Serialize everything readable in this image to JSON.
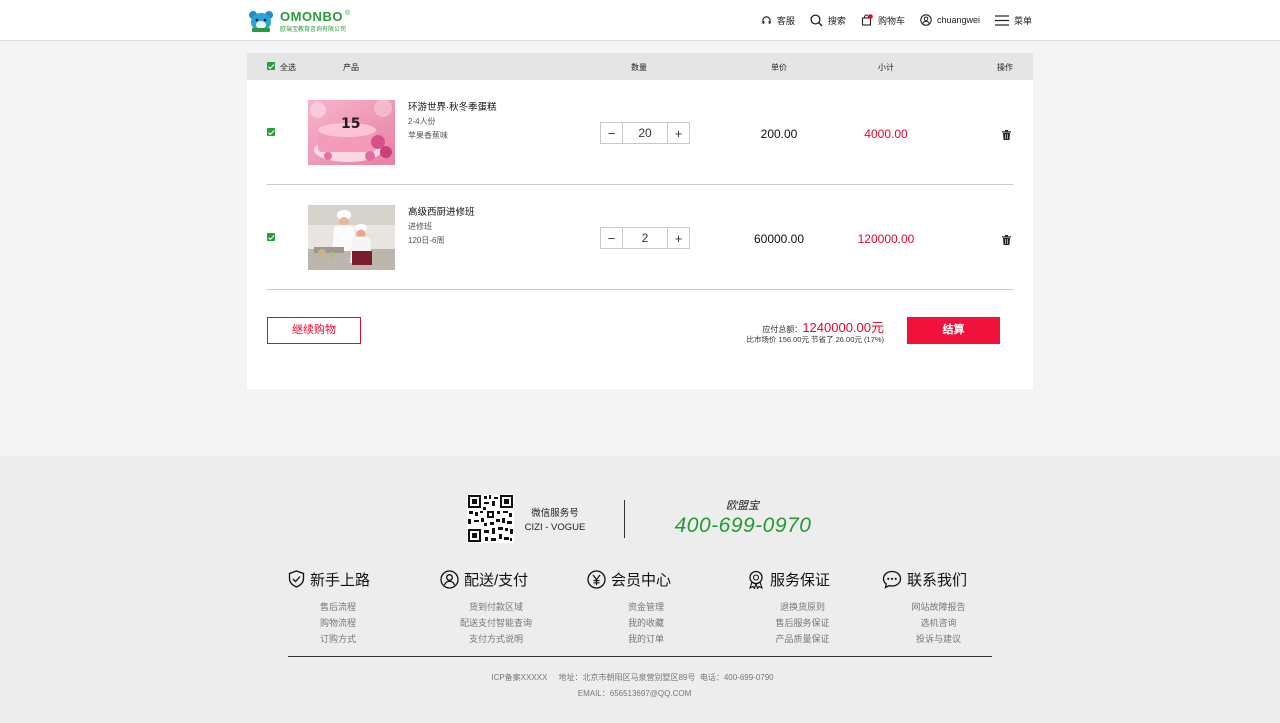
{
  "header": {
    "logo_brand": "OMONBO",
    "logo_reg": "®",
    "logo_sub": "欧瑞宝教育咨询有限公司",
    "nav": {
      "service": "客服",
      "search": "搜索",
      "cart": "购物车",
      "user": "chuangwei",
      "menu": "菜单"
    },
    "colors": {
      "brand_green": "#2a9a3d",
      "accent_red": "#e6072b"
    }
  },
  "cart": {
    "columns": {
      "select_all": "全选",
      "product": "产品",
      "quantity": "数量",
      "unit_price": "单价",
      "subtotal": "小计",
      "action": "操作"
    },
    "items": [
      {
        "name": "环游世界·秋冬季蛋糕",
        "attr1": "2-4人份",
        "attr2": "苹果香蕉味",
        "quantity": "20",
        "unit_price": "200.00",
        "subtotal": "4000.00",
        "checked": true
      },
      {
        "name": "高级西厨进修班",
        "attr1": "进修班",
        "attr2": "120日-6周",
        "quantity": "2",
        "unit_price": "60000.00",
        "subtotal": "120000.00",
        "checked": true
      }
    ],
    "continue_label": "继续购物",
    "total_label": "应付总额：",
    "total_amount": "1240000.00元",
    "total_note": "比市场价 156.00元 节省了 26.00元 (17%)",
    "checkout_label": "结算"
  },
  "footer": {
    "wechat_label": "微信服务号",
    "wechat_name": "CIZI - VOGUE",
    "brand_cn": "欧盟宝",
    "phone": "400-699-0970",
    "columns": [
      {
        "title": "新手上路",
        "icon": "shield-icon",
        "links": [
          "售后流程",
          "购物流程",
          "订购方式"
        ]
      },
      {
        "title": "配送/支付",
        "icon": "user-circle-icon",
        "links": [
          "货到付款区域",
          "配送支付智能查询",
          "支付方式说明"
        ]
      },
      {
        "title": "会员中心",
        "icon": "yen-icon",
        "links": [
          "资金管理",
          "我的收藏",
          "我的订单"
        ]
      },
      {
        "title": "服务保证",
        "icon": "award-icon",
        "links": [
          "退换货原则",
          "售后服务保证",
          "产品质量保证"
        ]
      },
      {
        "title": "联系我们",
        "icon": "chat-icon",
        "links": [
          "网站故障报告",
          "选机咨询",
          "投诉与建议"
        ]
      }
    ],
    "copyright": "ICP备案XXXXX     地址：北京市朝阳区马泉营别墅区89号  电话：400-699-0790",
    "email": "EMAIL：656513697@QQ.COM"
  }
}
